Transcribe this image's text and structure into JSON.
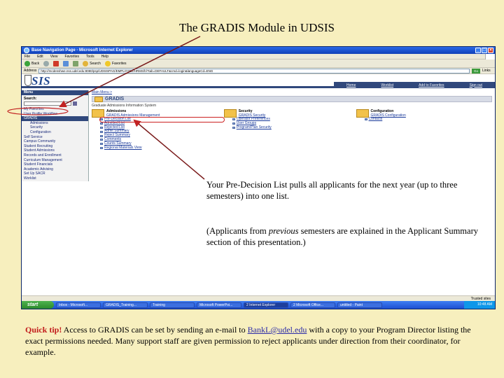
{
  "slide": {
    "title": "The GRADIS Module in UDSIS",
    "callout_line1": "Your Pre-Decision List pulls all applicants for the next year (up to three semesters) into one list.",
    "callout_part1": "(Applicants from ",
    "callout_italic": "previous",
    "callout_part2": " semesters are explained in the Applicant Summary section of this presentation.)",
    "tip_label": "Quick tip!",
    "tip_text1": " Access to GRADIS can be set by sending an e-mail to ",
    "tip_email": "BankL@udel.edu",
    "tip_text2": " with a copy to your Program Director listing the exact permissions needed.  Many support staff are given permission to reject applicants under direction from their coordinator, for example."
  },
  "browser": {
    "title": "Base Navigation Page - Microsoft Internet Explorer",
    "menu": [
      "File",
      "Edit",
      "View",
      "Favorites",
      "Tools",
      "Help"
    ],
    "toolbar": {
      "back": "Back",
      "search": "Search",
      "favorites": "Favorites"
    },
    "address_label": "Address",
    "address": "http://mcdenshwe.nss.udel.edu:8080/psp/UDSISPAG/EMPLOYEE/HRMS/h/?tab=DEFAULT&cmd=login&languageCd=ENG",
    "go": "Go",
    "links": "Links",
    "status_left": "",
    "status_zone": "Trusted sites"
  },
  "udsis": {
    "logo": "SIS",
    "nav": [
      "Home",
      "Worklist",
      "Add to Favorites",
      "Sign out"
    ]
  },
  "leftnav": {
    "menu_title": "Menu",
    "search_label": "Search:",
    "items": [
      {
        "label": "My Favorites",
        "sub": false,
        "hl": false
      },
      {
        "label": "User Profile Workflow",
        "sub": false,
        "hl": false
      },
      {
        "label": "GRADIS",
        "sub": false,
        "hl": true
      },
      {
        "label": "Admissions",
        "sub": true,
        "hl": false
      },
      {
        "label": "Security",
        "sub": true,
        "hl": false
      },
      {
        "label": "Configuration",
        "sub": true,
        "hl": false
      },
      {
        "label": "Self Service",
        "sub": false,
        "hl": false
      },
      {
        "label": "Campus Community",
        "sub": false,
        "hl": false
      },
      {
        "label": "Student Recruiting",
        "sub": false,
        "hl": false
      },
      {
        "label": "Student Admissions",
        "sub": false,
        "hl": false
      },
      {
        "label": "Records and Enrollment",
        "sub": false,
        "hl": false
      },
      {
        "label": "Curriculum Management",
        "sub": false,
        "hl": false
      },
      {
        "label": "Student Financials",
        "sub": false,
        "hl": false
      },
      {
        "label": "Academic Advising",
        "sub": false,
        "hl": false
      },
      {
        "label": "Set Up SACR",
        "sub": false,
        "hl": false
      },
      {
        "label": "Worklist",
        "sub": false,
        "hl": false
      },
      {
        "label": "Reporting Tools",
        "sub": false,
        "hl": false
      },
      {
        "label": "PeopleTools",
        "sub": false,
        "hl": false
      },
      {
        "label": "My Personalizations",
        "sub": false,
        "hl": false
      },
      {
        "label": "My Dictionary",
        "sub": false,
        "hl": false
      }
    ]
  },
  "main": {
    "breadcrumb": "Main Menu >",
    "page_title": "GRADIS",
    "page_sub": "Graduate Admissions Information System",
    "columns": [
      {
        "title": "Admissions",
        "subtitle": "GRADIS Admissions Management",
        "links": [
          "Pre-Decision List",
          "Admitted List",
          "Rejected List",
          "Admit Summary",
          "Reject Summary",
          "Comments",
          "Counts Summary",
          "Regional Materials View"
        ]
      },
      {
        "title": "Security",
        "subtitle": "GRADIS Security",
        "links": [
          "Operator Preferences",
          "User Groups",
          "Program/Plan Security"
        ]
      },
      {
        "title": "Configuration",
        "subtitle": "GRADIS Configuration",
        "links": [
          "Contacts"
        ]
      }
    ]
  },
  "taskbar": {
    "start": "start",
    "tasks": [
      "Inbox - Microsoft...",
      "GRADIS_Training...",
      "Training",
      "Microsoft PowerPoi...",
      "2 Internet Explorer",
      "2 Microsoft Office...",
      "untitled - Paint"
    ],
    "active_index": 4,
    "clock": "10:48 AM"
  },
  "colors": {
    "background": "#f7efbe",
    "udsis_blue": "#30487c",
    "tip_red": "#c21c1c",
    "annotation_red": "#c22222"
  }
}
